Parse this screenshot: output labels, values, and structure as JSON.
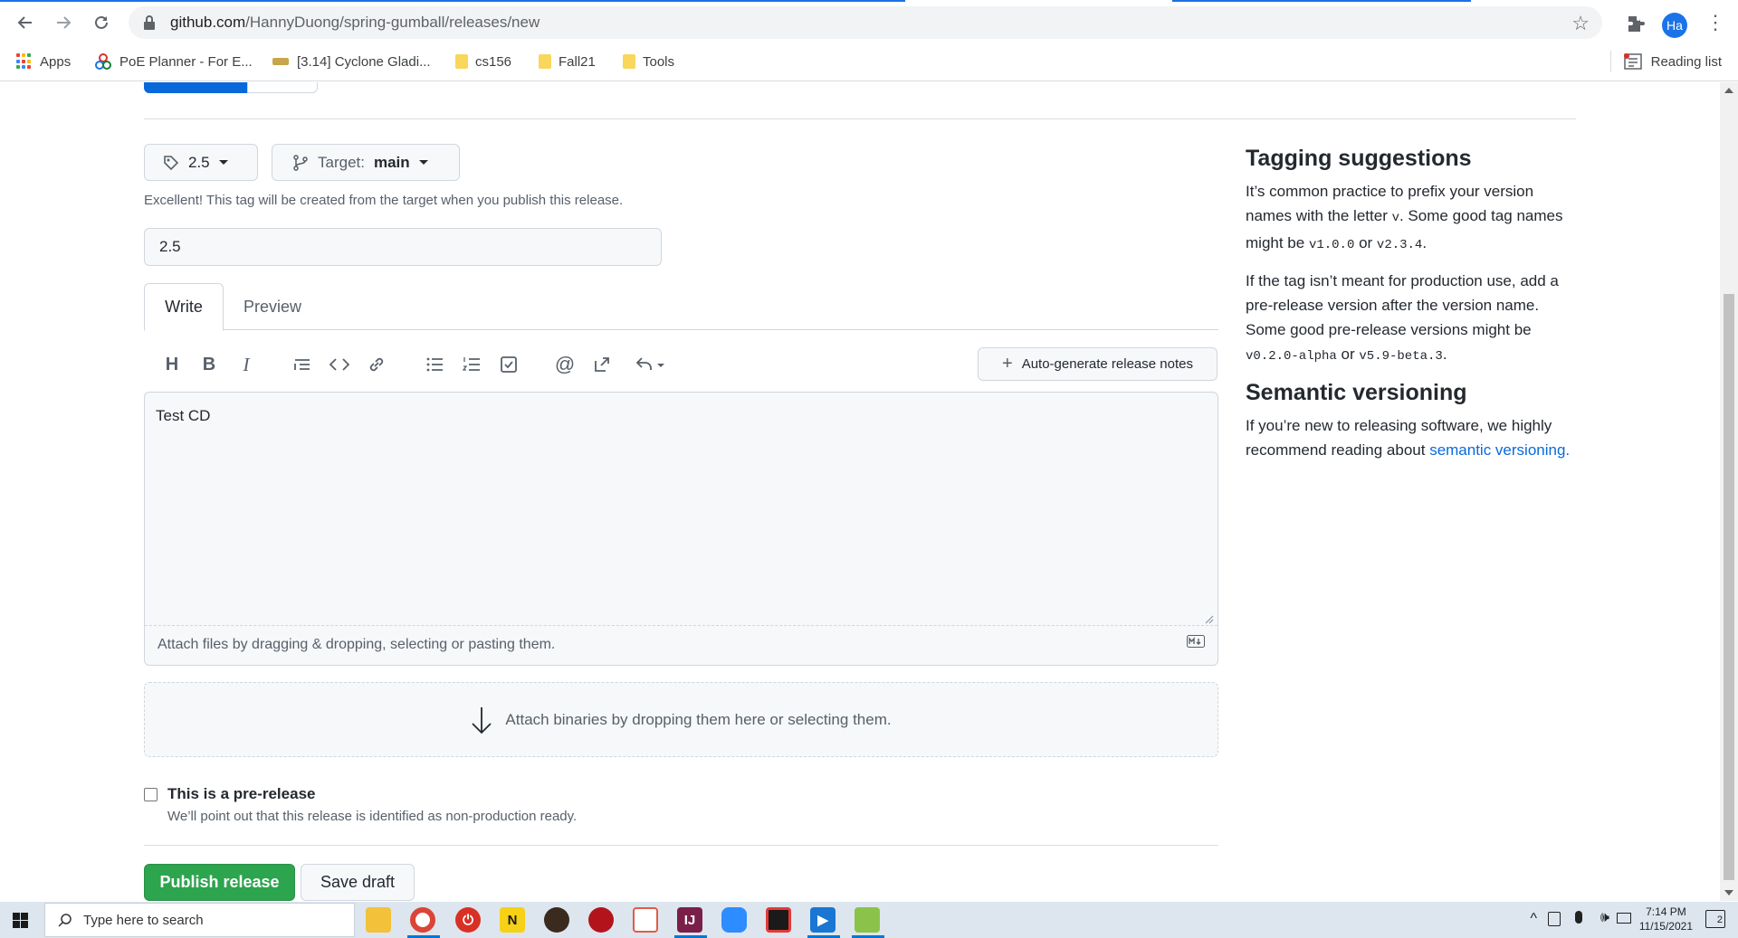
{
  "browser": {
    "url_host": "github.com",
    "url_path": "/HannyDuong/spring-gumball/releases/new",
    "profile_initials": "Ha",
    "bookmarks": [
      {
        "label": "Apps"
      },
      {
        "label": "PoE Planner - For E..."
      },
      {
        "label": "[3.14] Cyclone Gladi..."
      },
      {
        "label": "cs156"
      },
      {
        "label": "Fall21"
      },
      {
        "label": "Tools"
      }
    ],
    "reading_list": "Reading list"
  },
  "release_form": {
    "tag_value": "2.5",
    "target_label": "Target:",
    "target_value": "main",
    "tag_note": "Excellent! This tag will be created from the target when you publish this release.",
    "title_value": "2.5",
    "tabs": {
      "write": "Write",
      "preview": "Preview"
    },
    "auto_notes_label": "Auto-generate release notes",
    "body_text": "Test CD",
    "attach_files_text": "Attach files by dragging & dropping, selecting or pasting them.",
    "binaries_text": "Attach binaries by dropping them here or selecting them.",
    "prerelease_label": "This is a pre-release",
    "prerelease_desc": "We’ll point out that this release is identified as non-production ready.",
    "publish_label": "Publish release",
    "draft_label": "Save draft"
  },
  "sidebar": {
    "tagging_title": "Tagging suggestions",
    "tagging_p1_a": "It’s common practice to prefix your version names with the letter ",
    "tagging_p1_v": "v",
    "tagging_p1_b": ". Some good tag names might be ",
    "tagging_p1_c1": "v1.0.0",
    "tagging_p1_or": " or ",
    "tagging_p1_c2": "v2.3.4",
    "tagging_p1_end": ".",
    "tagging_p2_a": "If the tag isn’t meant for production use, add a pre-release version after the version name. Some good pre-release versions might be ",
    "tagging_p2_c1": "v0.2.0-alpha",
    "tagging_p2_or": " or ",
    "tagging_p2_c2": "v5.9-beta.3",
    "tagging_p2_end": ".",
    "semver_title": "Semantic versioning",
    "semver_p_a": "If you’re new to releasing software, we highly recommend reading about ",
    "semver_link": "semantic versioning."
  },
  "taskbar": {
    "search_placeholder": "Type here to search",
    "time": "7:14 PM",
    "date": "11/15/2021",
    "notification_count": "2"
  },
  "colors": {
    "primary_green": "#2da44e",
    "link_blue": "#0969da",
    "chrome_blue": "#1a73e8"
  }
}
